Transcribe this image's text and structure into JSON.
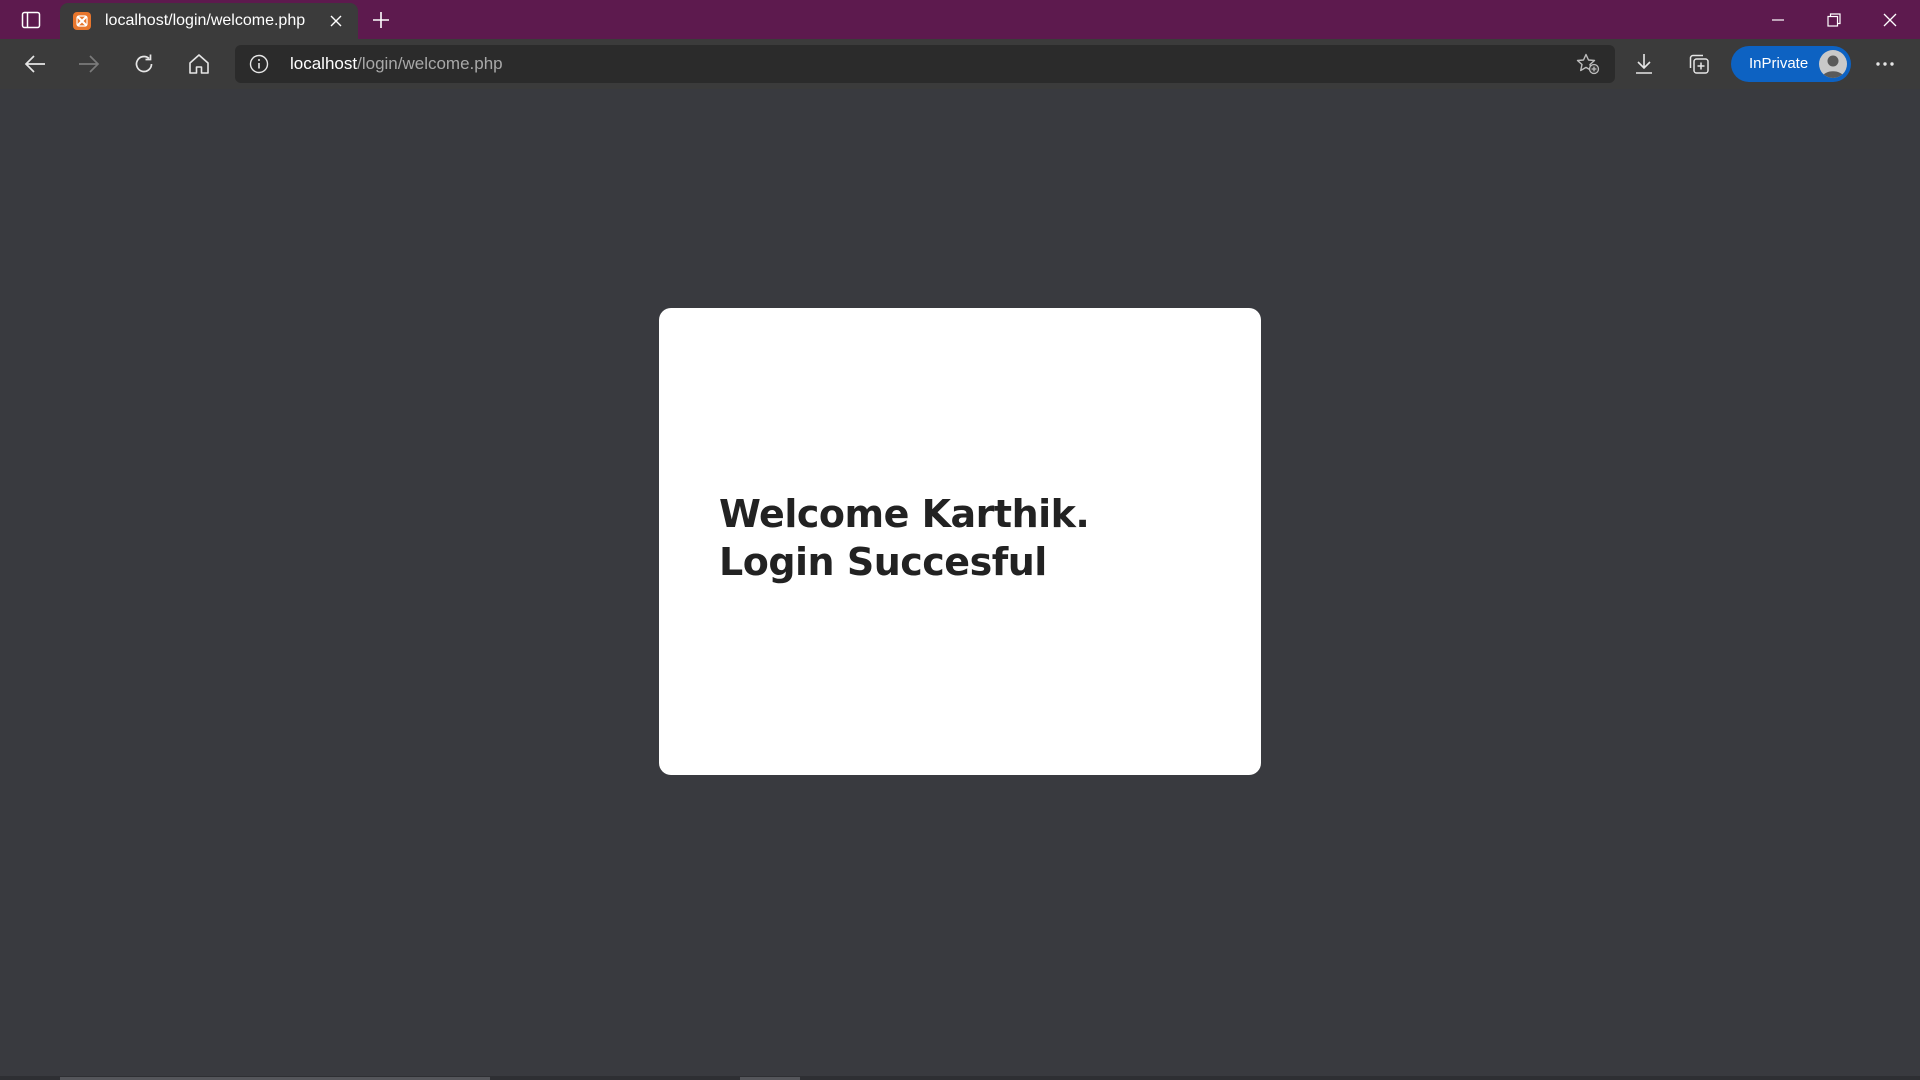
{
  "browser": {
    "tab": {
      "title": "localhost/login/welcome.php",
      "favicon": "xampp-icon"
    },
    "address": {
      "host": "localhost",
      "path": "/login/welcome.php"
    },
    "inprivate_label": "InPrivate",
    "colors": {
      "titlebar": "#5d1a4e",
      "toolbar": "#3b3b3b",
      "inprivate": "#0d62c2",
      "page_background": "#393a3f"
    }
  },
  "page": {
    "welcome_line1": "Welcome Karthik.",
    "welcome_line2": "Login Succesful"
  }
}
